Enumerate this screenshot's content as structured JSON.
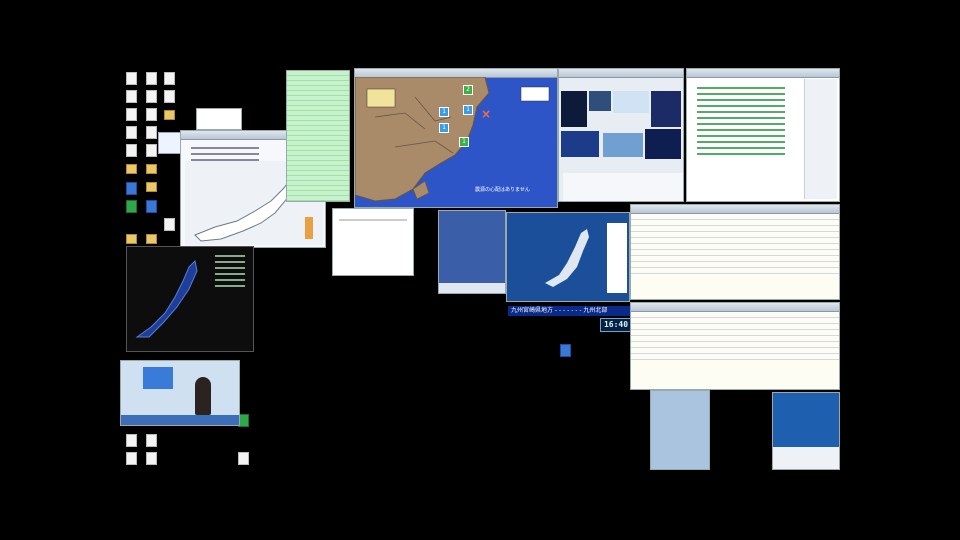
{
  "map_window": {
    "caption": "震源の心配はありません",
    "intensity_labels": [
      "2",
      "1",
      "1",
      "1",
      "1"
    ],
    "epicenter_mark": "×"
  },
  "news_ticker": {
    "text": "九州宮崎県地方 - - - - - - - 九州北部"
  },
  "clock": {
    "time": "16:40"
  },
  "colors": {
    "desktop_bg": "#000000",
    "map_sea": "#2e55c8",
    "map_land": "#a98b6a",
    "ticker_bg": "#0a2a8a"
  }
}
